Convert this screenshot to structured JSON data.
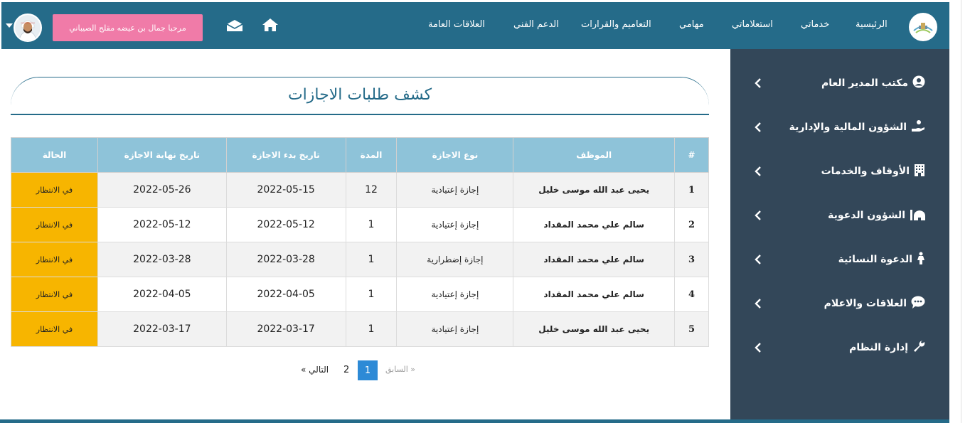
{
  "colors": {
    "navbar": "#256b89",
    "sidebar": "#334759",
    "table_header": "#8ec3d9",
    "status_pending": "#f7b500",
    "welcome_badge": "#f07ba8",
    "active_page": "#2d8ad6"
  },
  "nav": {
    "items": [
      "الرئيسية",
      "خدماتي",
      "استعلاماتي",
      "مهامي",
      "التعاميم والقرارات",
      "الدعم الفني",
      "العلاقات العامة"
    ],
    "welcome": "مرحبا جمال بن عيضه مقلح الصيباني",
    "home_icon": "home-icon",
    "mail_icon": "envelope-open-icon"
  },
  "sidebar": {
    "items": [
      {
        "label": "مكتب المدير العام",
        "icon": "user-circle-icon"
      },
      {
        "label": "الشؤون المالية والإدارية",
        "icon": "hand-holding-money-icon"
      },
      {
        "label": "الأوقاف والخدمات",
        "icon": "building-icon"
      },
      {
        "label": "الشؤون الدعوية",
        "icon": "mosque-icon"
      },
      {
        "label": "الدعوة النسائية",
        "icon": "female-icon"
      },
      {
        "label": "العلاقات والاعلام",
        "icon": "comment-dots-icon"
      },
      {
        "label": "إدارة النظام",
        "icon": "wrench-icon"
      }
    ]
  },
  "page": {
    "title": "كشف طلبات الاجازات"
  },
  "table": {
    "headers": [
      "#",
      "الموظف",
      "نوع الاجازة",
      "المدة",
      "تاريخ بدء الاجازة",
      "تاريخ نهاية الاجازة",
      "الحالة"
    ],
    "rows": [
      {
        "n": "1",
        "employee": "يحيى عبد الله موسى خليل",
        "type": "إجازة إعتيادية",
        "duration": "12",
        "start": "2022-05-15",
        "end": "2022-05-26",
        "status": "في الانتظار"
      },
      {
        "n": "2",
        "employee": "سالم علي محمد المقداد",
        "type": "إجازة إعتيادية",
        "duration": "1",
        "start": "2022-05-12",
        "end": "2022-05-12",
        "status": "في الانتظار"
      },
      {
        "n": "3",
        "employee": "سالم علي محمد المقداد",
        "type": "إجازة إضطرارية",
        "duration": "1",
        "start": "2022-03-28",
        "end": "2022-03-28",
        "status": "في الانتظار"
      },
      {
        "n": "4",
        "employee": "سالم علي محمد المقداد",
        "type": "إجازة إعتيادية",
        "duration": "1",
        "start": "2022-04-05",
        "end": "2022-04-05",
        "status": "في الانتظار"
      },
      {
        "n": "5",
        "employee": "يحيى عبد الله موسى خليل",
        "type": "إجازة إعتيادية",
        "duration": "1",
        "start": "2022-03-17",
        "end": "2022-03-17",
        "status": "في الانتظار"
      }
    ]
  },
  "pagination": {
    "prev": "« السابق",
    "pages": [
      "1",
      "2"
    ],
    "current": "1",
    "next": "التالي »"
  }
}
